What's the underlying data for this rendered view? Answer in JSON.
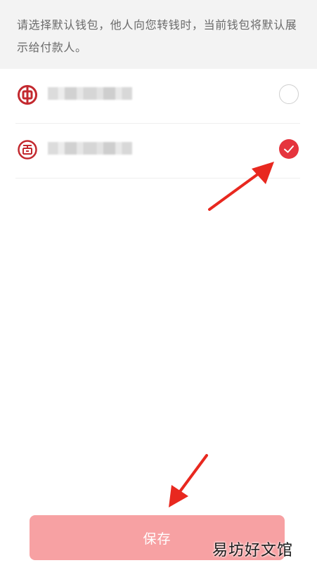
{
  "notice": {
    "text": "请选择默认钱包，他人向您转钱时，当前钱包将默认展示给付款人。"
  },
  "wallets": [
    {
      "bank_icon": "bank-of-china-icon",
      "name_masked": true,
      "selected": false
    },
    {
      "bank_icon": "icbc-icon",
      "name_masked": true,
      "selected": true
    }
  ],
  "actions": {
    "save_label": "保存"
  },
  "watermark": {
    "text": "易坊好文馆"
  },
  "colors": {
    "accent": "#e5343d",
    "bank_icon": "#c3292f",
    "save_button_bg": "#f7a1a3",
    "notice_bg": "#f3f3f3",
    "annotation_arrow": "#e8281f"
  }
}
